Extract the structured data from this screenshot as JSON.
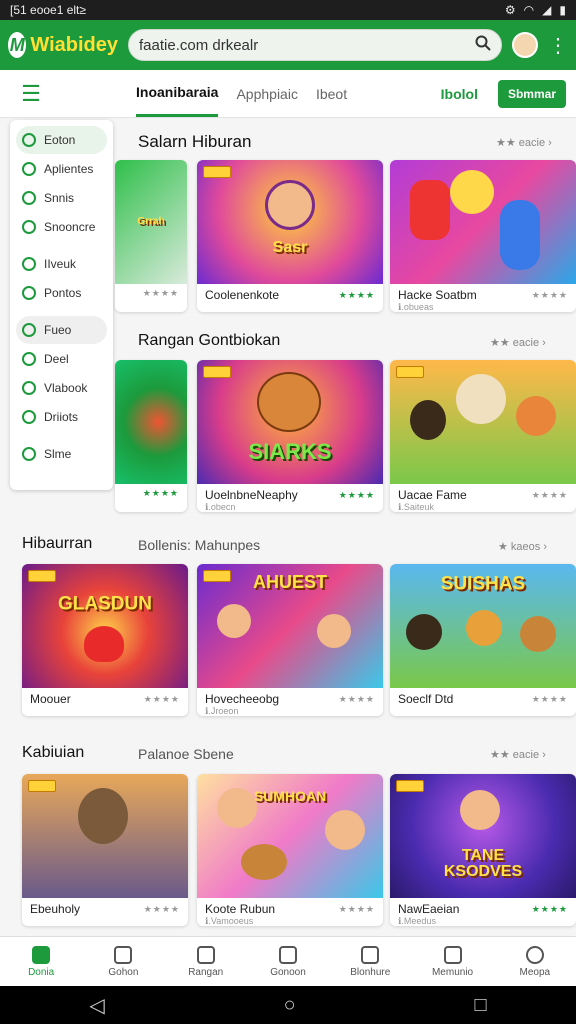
{
  "status": {
    "left": "[51 eooe1 elt≥",
    "icons": [
      "gear-icon",
      "wifi-icon",
      "signal-icon",
      "battery-icon"
    ]
  },
  "header": {
    "logo": "Wiabidey",
    "search_value": "faatie.com drkealr",
    "search_icon": "search-icon"
  },
  "tabs": {
    "items": [
      "Inoanibaraia",
      "Apphpiaic",
      "Ibeot"
    ],
    "filter": "Ibolol",
    "button": "Sbmmar"
  },
  "sidebar": {
    "items": [
      "Eoton",
      "Aplientes",
      "Snnis",
      "Snooncre",
      "IIveuk",
      "Pontos",
      "Fueo",
      "Deel",
      "Vlabook",
      "Driiots",
      "Slme"
    ]
  },
  "sections": [
    {
      "title": "Salarn Hiburan",
      "subtitle": "",
      "rating": "★★ eacie",
      "cards": [
        {
          "name": "",
          "sub": "",
          "stars": "★★★★",
          "art": "Grrah"
        },
        {
          "name": "Coolenenkote",
          "sub": "",
          "stars": "★★★★",
          "art": "Sasr"
        },
        {
          "name": "Hacke Soatbm",
          "sub": "ℹ.obueas",
          "stars": "★★★★",
          "art": ""
        }
      ]
    },
    {
      "title": "Rangan Gontbiokan",
      "subtitle": "",
      "rating": "★★ eacie",
      "cards": [
        {
          "name": "",
          "sub": "",
          "stars": "★★★★",
          "art": ""
        },
        {
          "name": "UoelnbneNeaphy",
          "sub": "ℹ.obecn",
          "stars": "★★★★",
          "art": "SIARKS"
        },
        {
          "name": "Uacae Fame",
          "sub": "ℹ.Saiteuk",
          "stars": "★★★★",
          "art": ""
        }
      ]
    },
    {
      "title": "Hibaurran",
      "subtitle": "Bollenis: Mahunpes",
      "rating": "★ kaeos",
      "cards": [
        {
          "name": "Moouer",
          "sub": "",
          "stars": "★★★★",
          "art": "GLASDUN"
        },
        {
          "name": "Hovecheeobg",
          "sub": "ℹ.Jroeon",
          "stars": "★★★★",
          "art": "AHUEST"
        },
        {
          "name": "Soeclf Dtd",
          "sub": "",
          "stars": "★★★★",
          "art": "SUISHAS"
        }
      ]
    },
    {
      "title": "Kabiuian",
      "subtitle": "Palanoe Sbene",
      "rating": "★★ eacie",
      "cards": [
        {
          "name": "Ebeuholy",
          "sub": "",
          "stars": "★★★★",
          "art": ""
        },
        {
          "name": "Koote Rubun",
          "sub": "ℹ.Vamooeus",
          "stars": "★★★★",
          "art": "SUMHOAN"
        },
        {
          "name": "NawEaeian",
          "sub": "ℹ.Meedus",
          "stars": "★★★★",
          "art": "TANE KSODVES"
        }
      ]
    }
  ],
  "bottom_nav": [
    "Donia",
    "Gohon",
    "Rangan",
    "Gonoon",
    "Blonhure",
    "Memunio",
    "Meopa"
  ],
  "colors": {
    "brand": "#1c9a3c",
    "accent": "#ffe033"
  }
}
